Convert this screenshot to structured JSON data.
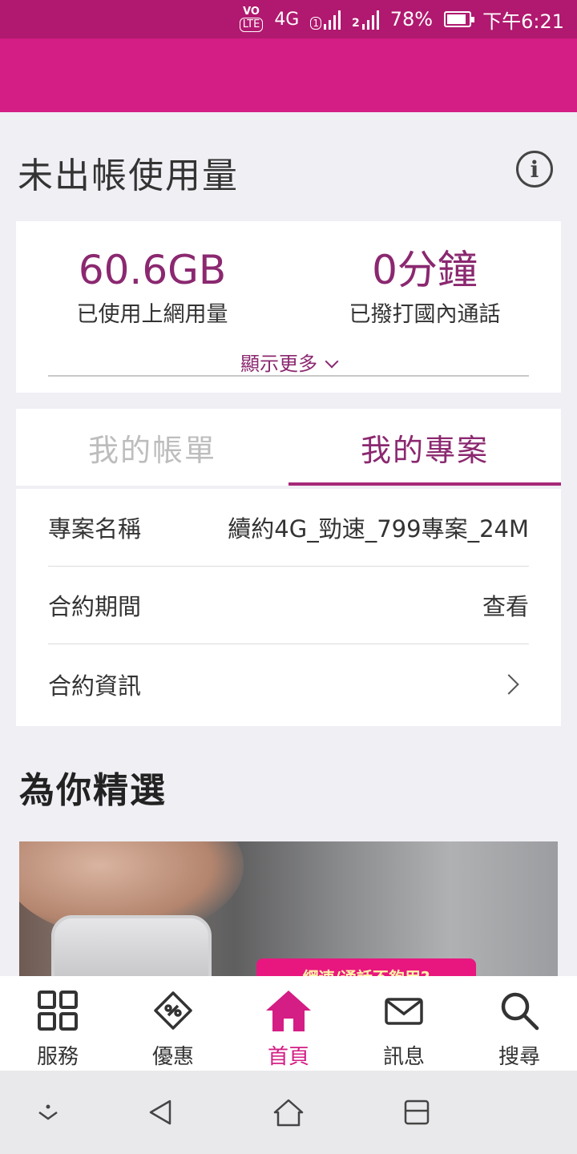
{
  "status_bar": {
    "volte": "VO",
    "lte": "LTE",
    "network": "4G",
    "sim1": "1",
    "sim2": "2",
    "battery_percent": "78%",
    "battery_level": 0.78,
    "time": "下午6:21"
  },
  "colors": {
    "brand": "#d41d85",
    "accent": "#8b2870",
    "status_bar": "#b0196f"
  },
  "usage": {
    "title": "未出帳使用量",
    "info_icon": "info-icon",
    "data_value": "60.6GB",
    "data_label": "已使用上網用量",
    "call_value": "0分鐘",
    "call_label": "已撥打國內通話",
    "show_more": "顯示更多"
  },
  "tabs": [
    {
      "label": "我的帳單",
      "selected": false
    },
    {
      "label": "我的專案",
      "selected": true
    }
  ],
  "plan": {
    "rows": [
      {
        "label": "專案名稱",
        "value": "續約4G_勁速_799專案_24M"
      },
      {
        "label": "合約期間",
        "value": "查看"
      },
      {
        "label": "合約資訊",
        "value": ""
      }
    ]
  },
  "picks": {
    "title": "為你精選",
    "banner_text": "網速/通話不夠用?"
  },
  "bottom_nav": [
    {
      "label": "服務",
      "icon": "grid-icon",
      "active": false
    },
    {
      "label": "優惠",
      "icon": "coupon-icon",
      "active": false
    },
    {
      "label": "首頁",
      "icon": "home-icon",
      "active": true
    },
    {
      "label": "訊息",
      "icon": "mail-icon",
      "active": false
    },
    {
      "label": "搜尋",
      "icon": "search-icon",
      "active": false
    }
  ],
  "system_nav": [
    "collapse-icon",
    "back-icon",
    "home-outline-icon",
    "recents-icon"
  ]
}
